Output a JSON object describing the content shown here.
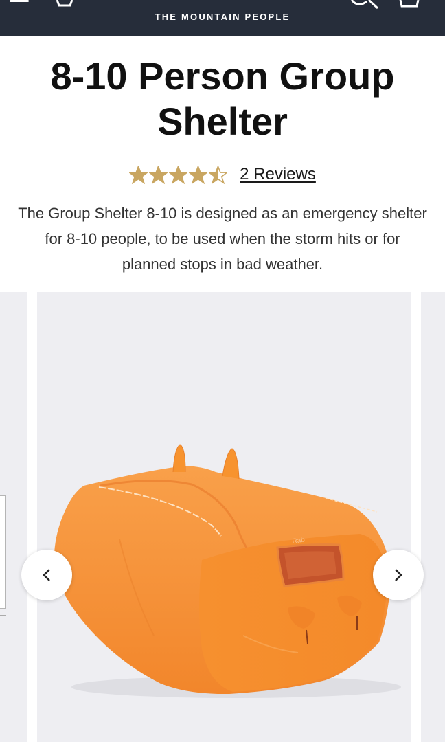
{
  "header": {
    "tagline": "THE MOUNTAIN PEOPLE",
    "background": "#262d3a",
    "icons": [
      "menu-icon",
      "account-icon",
      "search-icon",
      "bag-icon"
    ]
  },
  "product": {
    "title": "8-10 Person Group Shelter",
    "rating": {
      "value": 4.5,
      "max": 5,
      "star_color": "#c9a661"
    },
    "reviews_label": "2 Reviews",
    "description": "The Group Shelter 8-10 is designed as an emergency shelter for 8-10 people, to be used when the storm hits or for planned stops in bad weather."
  },
  "gallery": {
    "prev_icon": "chevron-left-icon",
    "next_icon": "chevron-right-icon",
    "image_brand_mark": "Rab",
    "shelter_color": "#f7932f"
  }
}
